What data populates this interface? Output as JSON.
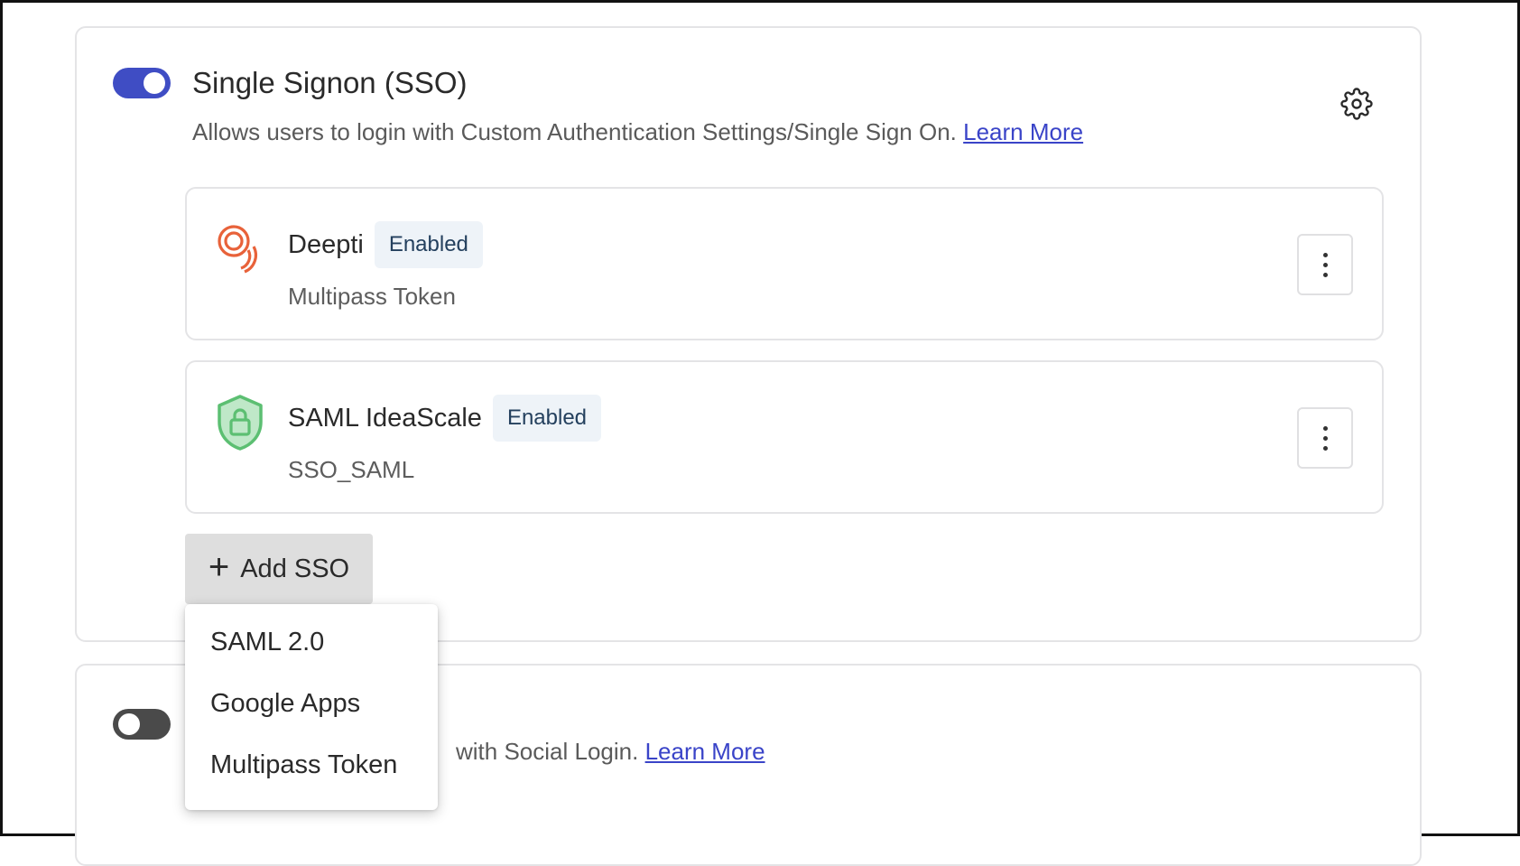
{
  "sso": {
    "title": "Single Signon (SSO)",
    "description": "Allows users to login with Custom Authentication Settings/Single Sign On.",
    "learn_more": "Learn More",
    "toggle_on": true,
    "providers": [
      {
        "name": "Deepti",
        "status": "Enabled",
        "type": "Multipass Token",
        "icon": "multipass-icon"
      },
      {
        "name": "SAML IdeaScale",
        "status": "Enabled",
        "type": "SSO_SAML",
        "icon": "shield-lock-icon"
      }
    ],
    "add_button": "Add SSO",
    "add_icon": "plus-icon"
  },
  "social": {
    "description_visible": "with Social Login.",
    "learn_more": "Learn More",
    "toggle_on": false
  },
  "dropdown": {
    "items": [
      "SAML 2.0",
      "Google Apps",
      "Multipass Token"
    ]
  },
  "colors": {
    "accent": "#3f4dc4",
    "badge_bg": "#eef3f8",
    "multipass_icon": "#e8623a",
    "saml_icon": "#5cbf72"
  }
}
